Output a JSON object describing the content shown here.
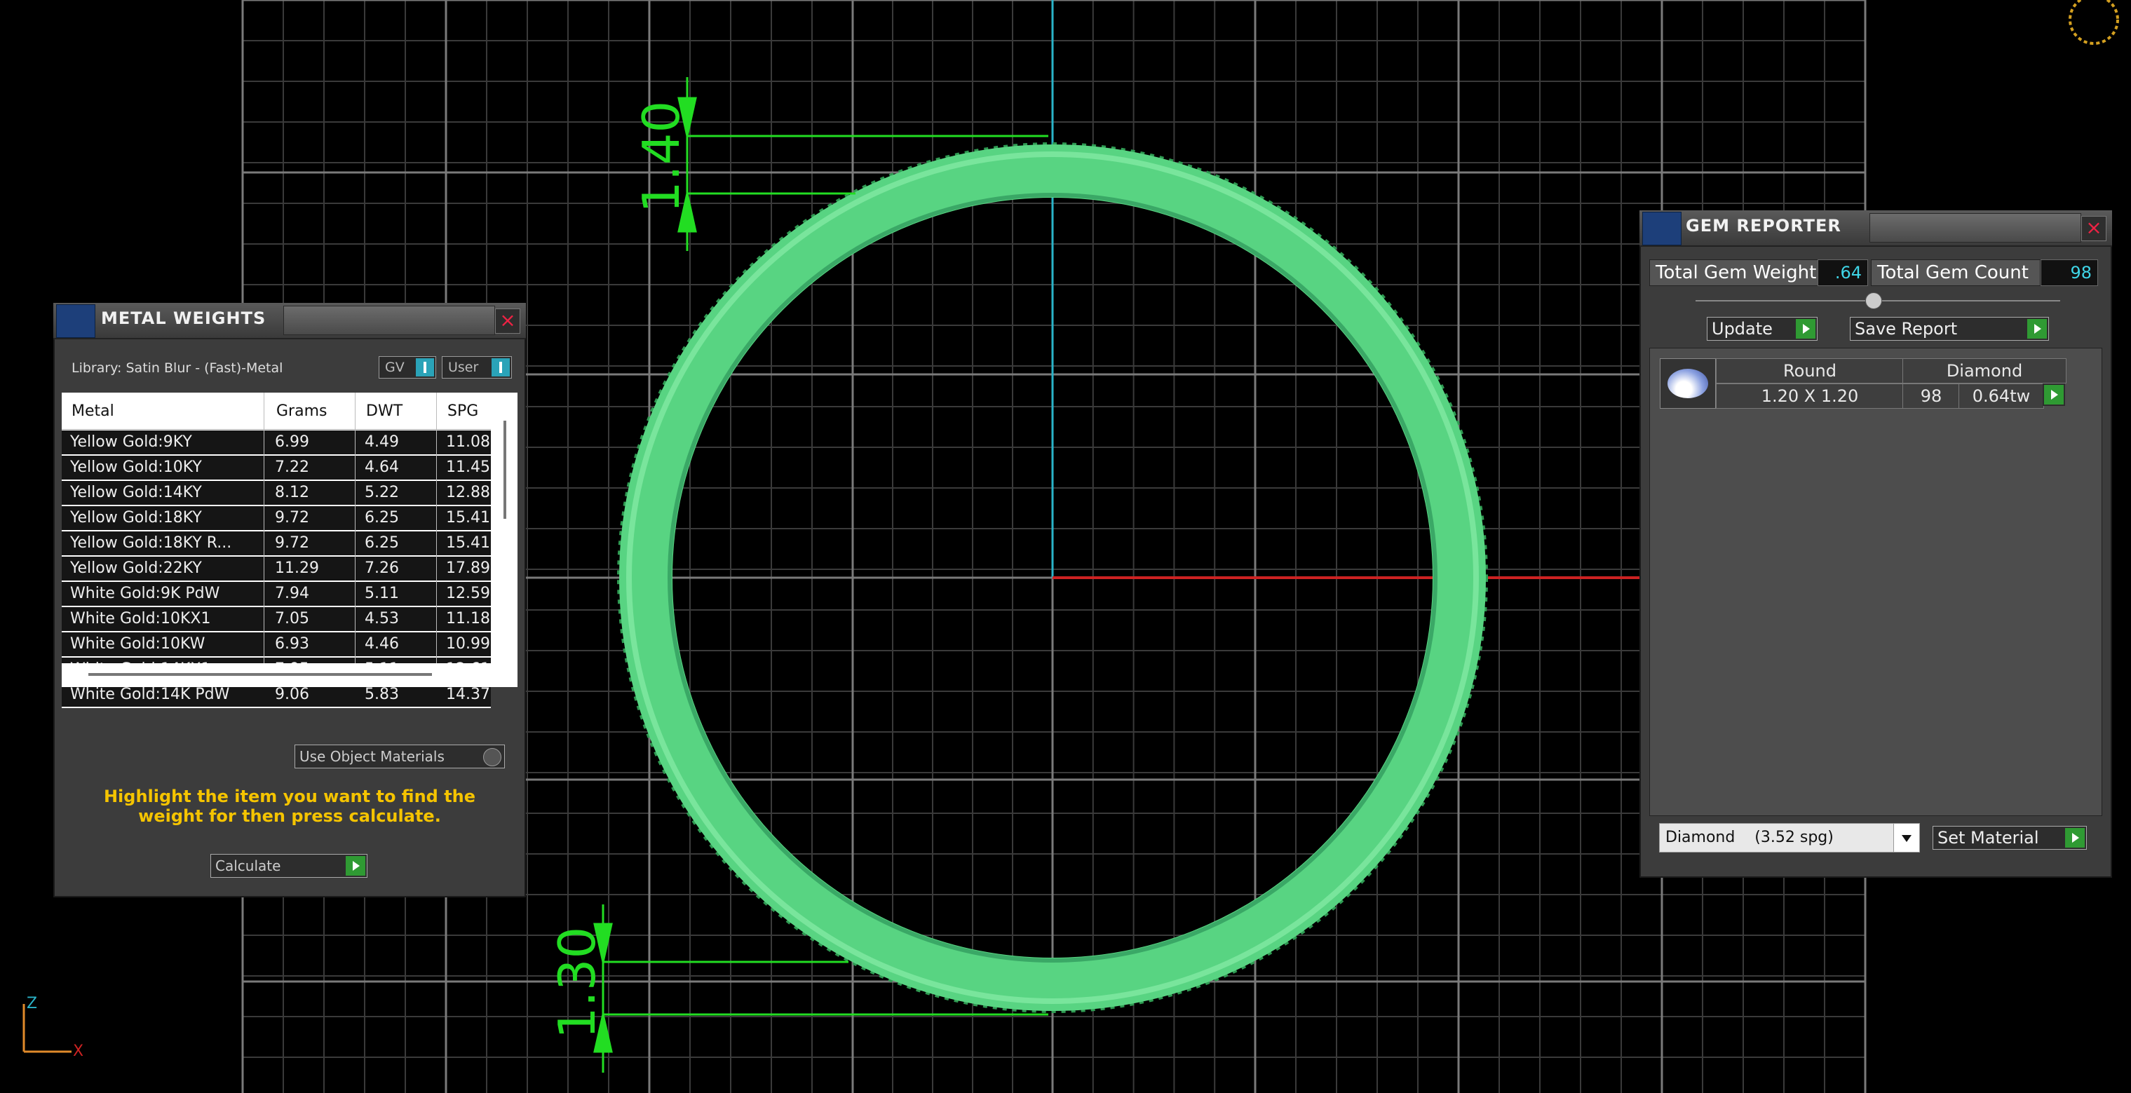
{
  "viewport": {
    "grid_color": "#7a7a7a",
    "ring_color": "#4fd07a",
    "dimension_color": "#22dd22",
    "axis_x_color": "#cc2222",
    "axis_z_color": "#2ab3c8",
    "dim_top": "1.40",
    "dim_bottom": "1.30",
    "axis_z": "Z",
    "axis_x": "X"
  },
  "metal_weights": {
    "title": "METAL WEIGHTS",
    "library": "Library: Satin Blur - (Fast)-Metal",
    "toggle_gv": "GV",
    "toggle_user": "User",
    "columns": [
      "Metal",
      "Grams",
      "DWT",
      "SPG"
    ],
    "rows": [
      [
        "Yellow Gold:9KY",
        "6.99",
        "4.49",
        "11.08"
      ],
      [
        "Yellow Gold:10KY",
        "7.22",
        "4.64",
        "11.45"
      ],
      [
        "Yellow Gold:14KY",
        "8.12",
        "5.22",
        "12.88"
      ],
      [
        "Yellow Gold:18KY",
        "9.72",
        "6.25",
        "15.41"
      ],
      [
        "Yellow Gold:18KY R...",
        "9.72",
        "6.25",
        "15.41"
      ],
      [
        "Yellow Gold:22KY",
        "11.29",
        "7.26",
        "17.89"
      ],
      [
        "White Gold:9K PdW",
        "7.94",
        "5.11",
        "12.59"
      ],
      [
        "White Gold:10KX1",
        "7.05",
        "4.53",
        "11.18"
      ],
      [
        "White Gold:10KW",
        "6.93",
        "4.46",
        "10.99"
      ],
      [
        "White Gold:14KX1",
        "7.95",
        "5.11",
        "12.61"
      ],
      [
        "White Gold:14K PdW",
        "9.06",
        "5.83",
        "14.37"
      ]
    ],
    "use_object_materials": "Use Object Materials",
    "hint": "Highlight the item you want to find the weight for then press calculate.",
    "calculate": "Calculate"
  },
  "gem_reporter": {
    "title": "GEM REPORTER",
    "total_weight_label": "Total Gem Weight",
    "total_weight_value": ".64",
    "total_count_label": "Total Gem Count",
    "total_count_value": "98",
    "update": "Update",
    "save_report": "Save Report",
    "gem": {
      "shape": "Round",
      "material": "Diamond",
      "size": "1.20 X 1.20",
      "count": "98",
      "weight": "0.64tw"
    },
    "material_select": "Diamond    (3.52 spg)",
    "set_material": "Set Material"
  }
}
